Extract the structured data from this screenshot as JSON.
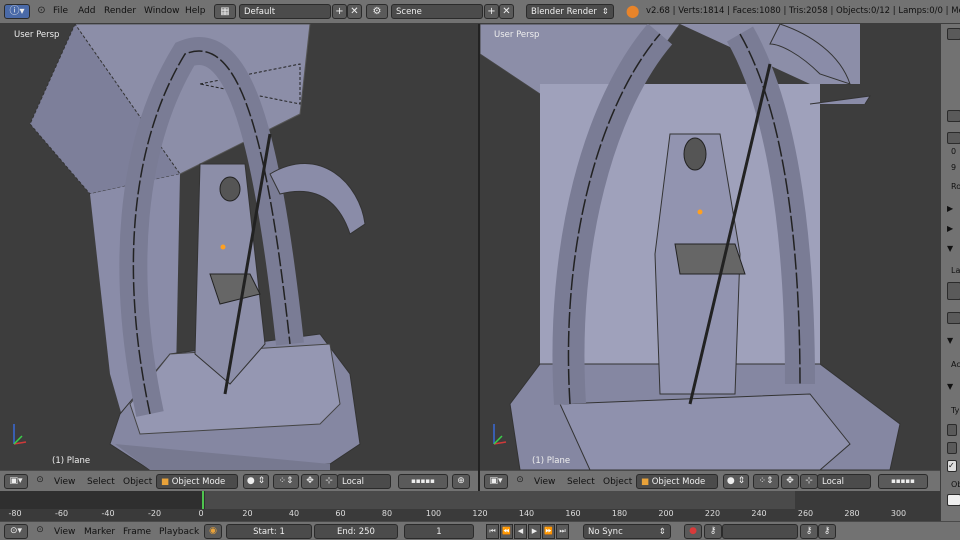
{
  "topbar": {
    "menus": [
      "File",
      "Add",
      "Render",
      "Window",
      "Help"
    ],
    "layout": "Default",
    "scene": "Scene",
    "engine": "Blender Render",
    "stats": "v2.68 | Verts:1814 | Faces:1080 | Tris:2058 | Objects:0/12 | Lamps:0/0 | Mem:"
  },
  "viewport_left": {
    "label": "User Persp",
    "object": "(1) Plane"
  },
  "viewport_right": {
    "label": "User Persp",
    "object": "(1) Plane"
  },
  "header_left": {
    "menus": [
      "View",
      "Select",
      "Object"
    ],
    "mode": "Object Mode",
    "orientation": "Local"
  },
  "header_right": {
    "menus": [
      "View",
      "Select",
      "Object"
    ],
    "mode": "Object Mode",
    "orientation": "Local"
  },
  "timeline": {
    "ticks": [
      "-80",
      "-60",
      "-40",
      "-20",
      "0",
      "20",
      "40",
      "60",
      "80",
      "100",
      "120",
      "140",
      "160",
      "180",
      "200",
      "220",
      "240",
      "260",
      "280",
      "300"
    ],
    "current_frame": 1
  },
  "bottombar": {
    "menus": [
      "View",
      "Marker",
      "Frame",
      "Playback"
    ],
    "start": "Start: 1",
    "end": "End: 250",
    "frame": "1",
    "sync": "No Sync"
  },
  "right_panel": {
    "labels": [
      "0",
      "9",
      "Ro",
      "La",
      "Ac",
      "Ty",
      "Ob"
    ]
  },
  "colors": {
    "header": "#727272",
    "viewport": "#3d3d3d",
    "mesh": "#8a8ca8",
    "active_frame": "#4ec34e"
  }
}
